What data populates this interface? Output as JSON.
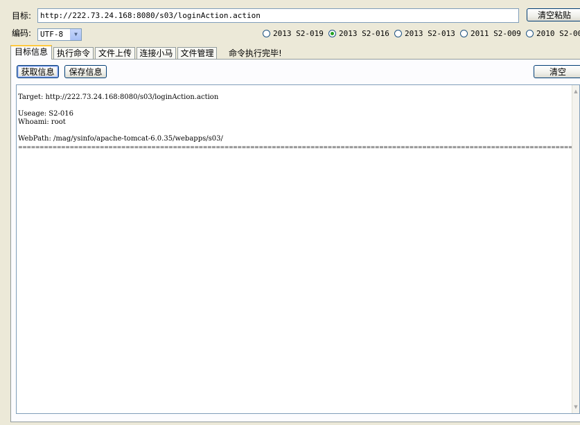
{
  "target": {
    "label": "目标:",
    "url": "http://222.73.24.168:8080/s03/loginAction.action",
    "clear_paste_label": "清空粘贴"
  },
  "encoding": {
    "label": "编码:",
    "selected": "UTF-8"
  },
  "versions": [
    {
      "label": "2013 S2-019",
      "checked": false
    },
    {
      "label": "2013 S2-016",
      "checked": true
    },
    {
      "label": "2013 S2-013",
      "checked": false
    },
    {
      "label": "2011 S2-009",
      "checked": false
    },
    {
      "label": "2010 S2-00",
      "checked": false
    }
  ],
  "tabs": [
    {
      "label": "目标信息",
      "active": true
    },
    {
      "label": "执行命令",
      "active": false
    },
    {
      "label": "文件上传",
      "active": false
    },
    {
      "label": "连接小马",
      "active": false
    },
    {
      "label": "文件管理",
      "active": false
    }
  ],
  "status": "命令执行完毕!",
  "actions": {
    "get_info": "获取信息",
    "save_info": "保存信息",
    "clear": "清空"
  },
  "output": {
    "line1": "Target: http://222.73.24.168:8080/s03/loginAction.action",
    "line2": "",
    "line3": "Useage: S2-016",
    "line4": "Whoami: root",
    "line5": "",
    "line6": "WebPath: /mag/ysinfo/apache-tomcat-6.0.35/webapps/s03/",
    "line7": "========================================================================================================================================"
  },
  "icons": {
    "dropdown": "chevron-down-icon",
    "scroll_up": "arrow-up-icon",
    "scroll_down": "arrow-down-icon"
  }
}
